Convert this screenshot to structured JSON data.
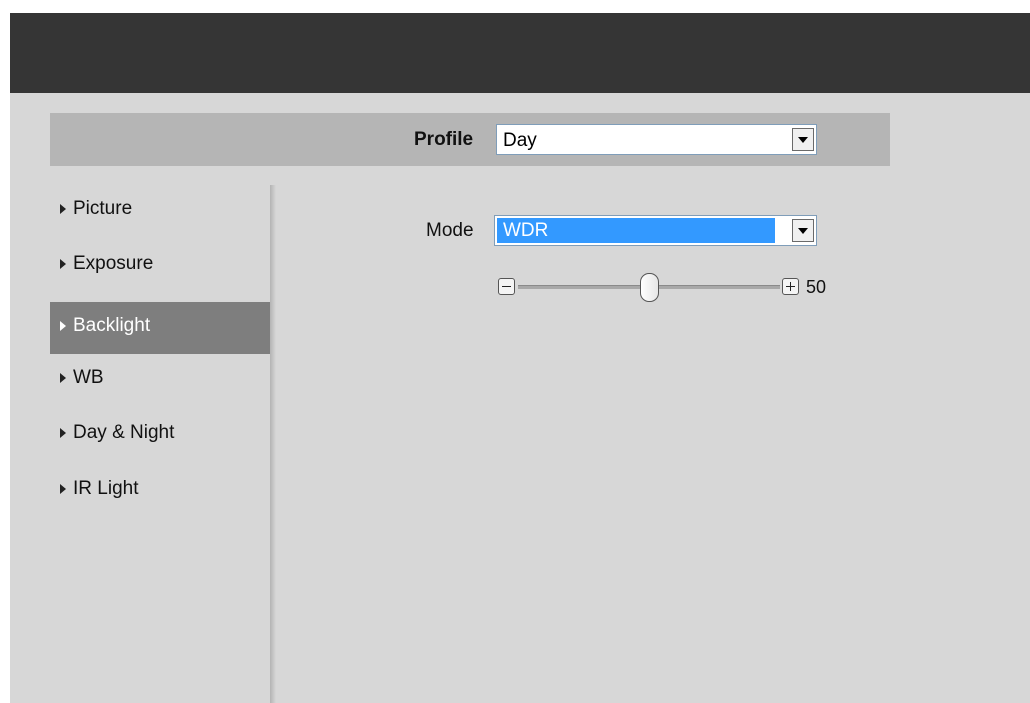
{
  "profile": {
    "label": "Profile",
    "value": "Day"
  },
  "sidebar": {
    "items": [
      {
        "label": "Picture",
        "active": false
      },
      {
        "label": "Exposure",
        "active": false
      },
      {
        "label": "Backlight",
        "active": true
      },
      {
        "label": "WB",
        "active": false
      },
      {
        "label": "Day & Night",
        "active": false
      },
      {
        "label": "IR Light",
        "active": false
      }
    ]
  },
  "backlight": {
    "mode_label": "Mode",
    "mode_value": "WDR",
    "level": 50,
    "level_text": "50",
    "level_range": [
      0,
      100
    ]
  },
  "icons": {
    "nav_marker": "triangle-right-icon",
    "dropdown": "chevron-down-icon",
    "decrease": "minus-icon",
    "increase": "plus-icon"
  },
  "colors": {
    "header": "#353535",
    "background": "#d7d7d7",
    "active_item": "#7e7e7e",
    "selection": "#3399ff"
  }
}
